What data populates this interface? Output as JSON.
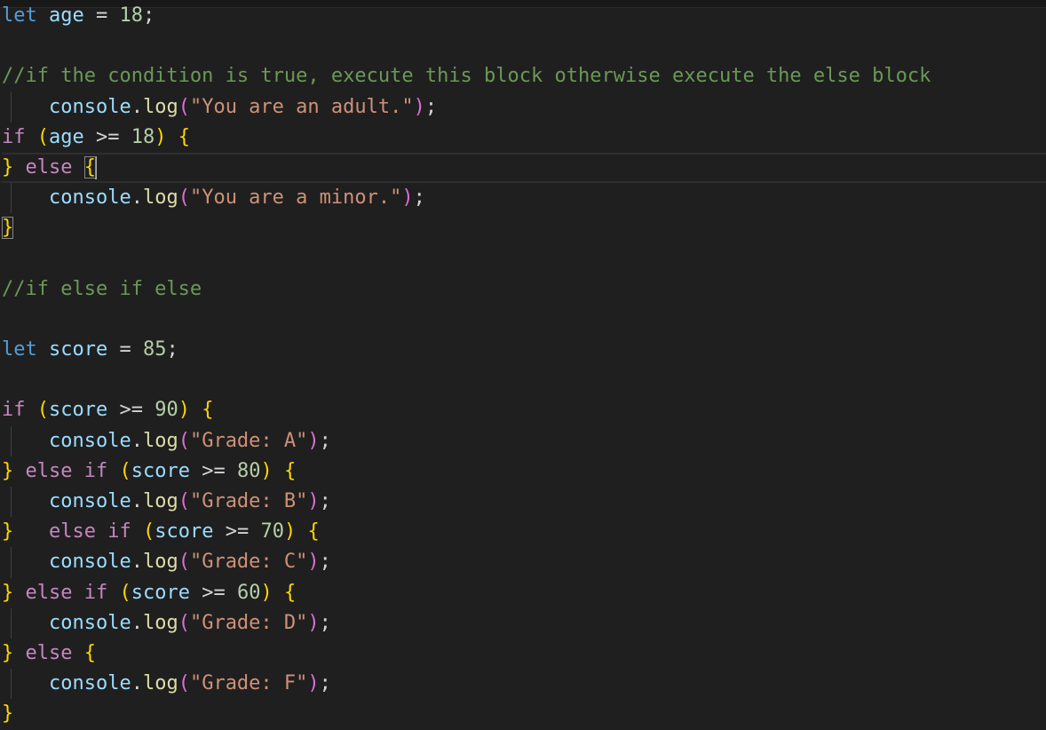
{
  "editor": {
    "language": "javascript",
    "cursor_line": 6,
    "lines": [
      {
        "indent": false,
        "tokens": [
          {
            "t": "let",
            "c": "kw"
          },
          {
            "t": " ",
            "c": "op"
          },
          {
            "t": "age",
            "c": "var"
          },
          {
            "t": " = ",
            "c": "op"
          },
          {
            "t": "18",
            "c": "num"
          },
          {
            "t": ";",
            "c": "pun"
          }
        ]
      },
      {
        "indent": false,
        "tokens": []
      },
      {
        "indent": false,
        "tokens": [
          {
            "t": "//if the condition is true, execute this block otherwise execute the else block",
            "c": "cmt"
          }
        ]
      },
      {
        "indent": true,
        "tokens": [
          {
            "t": "    ",
            "c": "op"
          },
          {
            "t": "console",
            "c": "var"
          },
          {
            "t": ".",
            "c": "pun"
          },
          {
            "t": "log",
            "c": "fn"
          },
          {
            "t": "(",
            "c": "br2"
          },
          {
            "t": "\"You are an adult.\"",
            "c": "str"
          },
          {
            "t": ")",
            "c": "br2"
          },
          {
            "t": ";",
            "c": "pun"
          }
        ]
      },
      {
        "indent": false,
        "tokens": [
          {
            "t": "if",
            "c": "ctl"
          },
          {
            "t": " ",
            "c": "op"
          },
          {
            "t": "(",
            "c": "br1"
          },
          {
            "t": "age",
            "c": "var"
          },
          {
            "t": " >= ",
            "c": "op"
          },
          {
            "t": "18",
            "c": "num"
          },
          {
            "t": ")",
            "c": "br1"
          },
          {
            "t": " ",
            "c": "op"
          },
          {
            "t": "{",
            "c": "br1"
          }
        ]
      },
      {
        "indent": false,
        "current": true,
        "tokens": [
          {
            "t": "}",
            "c": "br1"
          },
          {
            "t": " ",
            "c": "op"
          },
          {
            "t": "else",
            "c": "ctl"
          },
          {
            "t": " ",
            "c": "op"
          },
          {
            "t": "{",
            "c": "br1",
            "match": true
          },
          {
            "t": "",
            "c": "cursor"
          }
        ]
      },
      {
        "indent": true,
        "tokens": [
          {
            "t": "    ",
            "c": "op"
          },
          {
            "t": "console",
            "c": "var"
          },
          {
            "t": ".",
            "c": "pun"
          },
          {
            "t": "log",
            "c": "fn"
          },
          {
            "t": "(",
            "c": "br2"
          },
          {
            "t": "\"You are a minor.\"",
            "c": "str"
          },
          {
            "t": ")",
            "c": "br2"
          },
          {
            "t": ";",
            "c": "pun"
          }
        ]
      },
      {
        "indent": false,
        "tokens": [
          {
            "t": "}",
            "c": "br1",
            "match": true
          }
        ]
      },
      {
        "indent": false,
        "tokens": []
      },
      {
        "indent": false,
        "tokens": [
          {
            "t": "//if else if else",
            "c": "cmt"
          }
        ]
      },
      {
        "indent": false,
        "tokens": []
      },
      {
        "indent": false,
        "tokens": [
          {
            "t": "let",
            "c": "kw"
          },
          {
            "t": " ",
            "c": "op"
          },
          {
            "t": "score",
            "c": "var"
          },
          {
            "t": " = ",
            "c": "op"
          },
          {
            "t": "85",
            "c": "num"
          },
          {
            "t": ";",
            "c": "pun"
          }
        ]
      },
      {
        "indent": false,
        "tokens": []
      },
      {
        "indent": false,
        "tokens": [
          {
            "t": "if",
            "c": "ctl"
          },
          {
            "t": " ",
            "c": "op"
          },
          {
            "t": "(",
            "c": "br1"
          },
          {
            "t": "score",
            "c": "var"
          },
          {
            "t": " >= ",
            "c": "op"
          },
          {
            "t": "90",
            "c": "num"
          },
          {
            "t": ")",
            "c": "br1"
          },
          {
            "t": " ",
            "c": "op"
          },
          {
            "t": "{",
            "c": "br1"
          }
        ]
      },
      {
        "indent": true,
        "tokens": [
          {
            "t": "    ",
            "c": "op"
          },
          {
            "t": "console",
            "c": "var"
          },
          {
            "t": ".",
            "c": "pun"
          },
          {
            "t": "log",
            "c": "fn"
          },
          {
            "t": "(",
            "c": "br2"
          },
          {
            "t": "\"Grade: A\"",
            "c": "str"
          },
          {
            "t": ")",
            "c": "br2"
          },
          {
            "t": ";",
            "c": "pun"
          }
        ]
      },
      {
        "indent": false,
        "tokens": [
          {
            "t": "}",
            "c": "br1"
          },
          {
            "t": " ",
            "c": "op"
          },
          {
            "t": "else",
            "c": "ctl"
          },
          {
            "t": " ",
            "c": "op"
          },
          {
            "t": "if",
            "c": "ctl"
          },
          {
            "t": " ",
            "c": "op"
          },
          {
            "t": "(",
            "c": "br1"
          },
          {
            "t": "score",
            "c": "var"
          },
          {
            "t": " >= ",
            "c": "op"
          },
          {
            "t": "80",
            "c": "num"
          },
          {
            "t": ")",
            "c": "br1"
          },
          {
            "t": " ",
            "c": "op"
          },
          {
            "t": "{",
            "c": "br1"
          }
        ]
      },
      {
        "indent": true,
        "tokens": [
          {
            "t": "    ",
            "c": "op"
          },
          {
            "t": "console",
            "c": "var"
          },
          {
            "t": ".",
            "c": "pun"
          },
          {
            "t": "log",
            "c": "fn"
          },
          {
            "t": "(",
            "c": "br2"
          },
          {
            "t": "\"Grade: B\"",
            "c": "str"
          },
          {
            "t": ")",
            "c": "br2"
          },
          {
            "t": ";",
            "c": "pun"
          }
        ]
      },
      {
        "indent": false,
        "tokens": [
          {
            "t": "}",
            "c": "br1"
          },
          {
            "t": "   ",
            "c": "op"
          },
          {
            "t": "else",
            "c": "ctl"
          },
          {
            "t": " ",
            "c": "op"
          },
          {
            "t": "if",
            "c": "ctl"
          },
          {
            "t": " ",
            "c": "op"
          },
          {
            "t": "(",
            "c": "br1"
          },
          {
            "t": "score",
            "c": "var"
          },
          {
            "t": " >= ",
            "c": "op"
          },
          {
            "t": "70",
            "c": "num"
          },
          {
            "t": ")",
            "c": "br1"
          },
          {
            "t": " ",
            "c": "op"
          },
          {
            "t": "{",
            "c": "br1"
          }
        ]
      },
      {
        "indent": true,
        "tokens": [
          {
            "t": "    ",
            "c": "op"
          },
          {
            "t": "console",
            "c": "var"
          },
          {
            "t": ".",
            "c": "pun"
          },
          {
            "t": "log",
            "c": "fn"
          },
          {
            "t": "(",
            "c": "br2"
          },
          {
            "t": "\"Grade: C\"",
            "c": "str"
          },
          {
            "t": ")",
            "c": "br2"
          },
          {
            "t": ";",
            "c": "pun"
          }
        ]
      },
      {
        "indent": false,
        "tokens": [
          {
            "t": "}",
            "c": "br1"
          },
          {
            "t": " ",
            "c": "op"
          },
          {
            "t": "else",
            "c": "ctl"
          },
          {
            "t": " ",
            "c": "op"
          },
          {
            "t": "if",
            "c": "ctl"
          },
          {
            "t": " ",
            "c": "op"
          },
          {
            "t": "(",
            "c": "br1"
          },
          {
            "t": "score",
            "c": "var"
          },
          {
            "t": " >= ",
            "c": "op"
          },
          {
            "t": "60",
            "c": "num"
          },
          {
            "t": ")",
            "c": "br1"
          },
          {
            "t": " ",
            "c": "op"
          },
          {
            "t": "{",
            "c": "br1"
          }
        ]
      },
      {
        "indent": true,
        "tokens": [
          {
            "t": "    ",
            "c": "op"
          },
          {
            "t": "console",
            "c": "var"
          },
          {
            "t": ".",
            "c": "pun"
          },
          {
            "t": "log",
            "c": "fn"
          },
          {
            "t": "(",
            "c": "br2"
          },
          {
            "t": "\"Grade: D\"",
            "c": "str"
          },
          {
            "t": ")",
            "c": "br2"
          },
          {
            "t": ";",
            "c": "pun"
          }
        ]
      },
      {
        "indent": false,
        "tokens": [
          {
            "t": "}",
            "c": "br1"
          },
          {
            "t": " ",
            "c": "op"
          },
          {
            "t": "else",
            "c": "ctl"
          },
          {
            "t": " ",
            "c": "op"
          },
          {
            "t": "{",
            "c": "br1"
          }
        ]
      },
      {
        "indent": true,
        "tokens": [
          {
            "t": "    ",
            "c": "op"
          },
          {
            "t": "console",
            "c": "var"
          },
          {
            "t": ".",
            "c": "pun"
          },
          {
            "t": "log",
            "c": "fn"
          },
          {
            "t": "(",
            "c": "br2"
          },
          {
            "t": "\"Grade: F\"",
            "c": "str"
          },
          {
            "t": ")",
            "c": "br2"
          },
          {
            "t": ";",
            "c": "pun"
          }
        ]
      },
      {
        "indent": false,
        "tokens": [
          {
            "t": "}",
            "c": "br1"
          }
        ]
      }
    ]
  },
  "colors": {
    "background": "#1f1f1f",
    "keyword": "#569cd6",
    "control": "#c586c0",
    "variable": "#9cdcfe",
    "function": "#dcdcaa",
    "number": "#b5cea8",
    "string": "#ce9178",
    "comment": "#6a9955",
    "bracket_level1": "#ffd700",
    "bracket_level2": "#da70d6"
  }
}
